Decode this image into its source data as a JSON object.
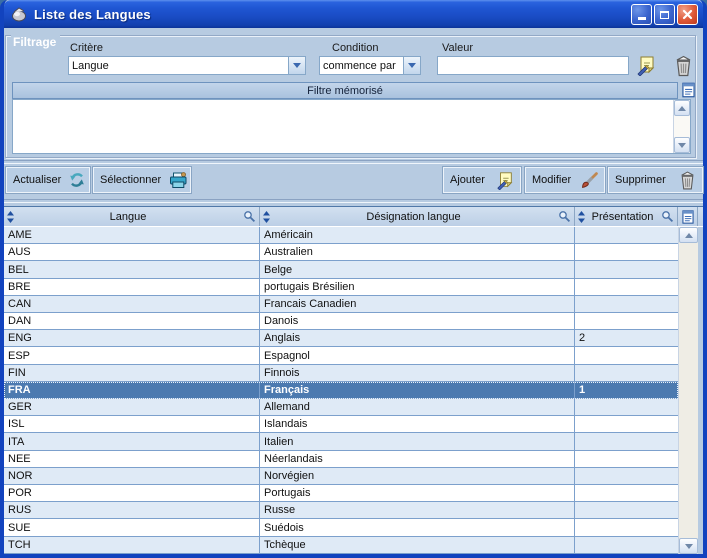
{
  "window": {
    "title": "Liste des Langues"
  },
  "filter": {
    "group_label": "Filtrage",
    "criterion_label": "Critère",
    "criterion_value": "Langue",
    "condition_label": "Condition",
    "condition_value": "commence par",
    "value_label": "Valeur",
    "value_text": "",
    "memorized_filter_header": "Filtre mémorisé"
  },
  "toolbar": {
    "refresh_label": "Actualiser",
    "select_label": "Sélectionner",
    "add_label": "Ajouter",
    "modify_label": "Modifier",
    "delete_label": "Supprimer"
  },
  "table": {
    "columns": [
      {
        "label": "Langue"
      },
      {
        "label": "Désignation langue"
      },
      {
        "label": "Présentation"
      }
    ],
    "selected_code": "FRA",
    "rows": [
      {
        "code": "AME",
        "designation": "Américain",
        "presentation": ""
      },
      {
        "code": "AUS",
        "designation": "Australien",
        "presentation": ""
      },
      {
        "code": "BEL",
        "designation": "Belge",
        "presentation": ""
      },
      {
        "code": "BRE",
        "designation": "portugais Brésilien",
        "presentation": ""
      },
      {
        "code": "CAN",
        "designation": "Francais Canadien",
        "presentation": ""
      },
      {
        "code": "DAN",
        "designation": "Danois",
        "presentation": ""
      },
      {
        "code": "ENG",
        "designation": "Anglais",
        "presentation": "2"
      },
      {
        "code": "ESP",
        "designation": "Espagnol",
        "presentation": ""
      },
      {
        "code": "FIN",
        "designation": "Finnois",
        "presentation": ""
      },
      {
        "code": "FRA",
        "designation": "Français",
        "presentation": "1"
      },
      {
        "code": "GER",
        "designation": "Allemand",
        "presentation": ""
      },
      {
        "code": "ISL",
        "designation": "Islandais",
        "presentation": ""
      },
      {
        "code": "ITA",
        "designation": "Italien",
        "presentation": ""
      },
      {
        "code": "NEE",
        "designation": "Néerlandais",
        "presentation": ""
      },
      {
        "code": "NOR",
        "designation": "Norvégien",
        "presentation": ""
      },
      {
        "code": "POR",
        "designation": "Portugais",
        "presentation": ""
      },
      {
        "code": "RUS",
        "designation": "Russe",
        "presentation": ""
      },
      {
        "code": "SUE",
        "designation": "Suédois",
        "presentation": ""
      },
      {
        "code": "TCH",
        "designation": "Tchèque",
        "presentation": ""
      }
    ]
  },
  "colors": {
    "titlebar_blue": "#1A4CC4",
    "window_border": "#1243BE",
    "client_bg": "#B7CBE1",
    "header_bg": "#C6D8EC",
    "alt_row": "#DFEAF6",
    "row_line": "#7CA0CC",
    "selected_row": "#4C7AB0",
    "close_red": "#DE5838"
  }
}
